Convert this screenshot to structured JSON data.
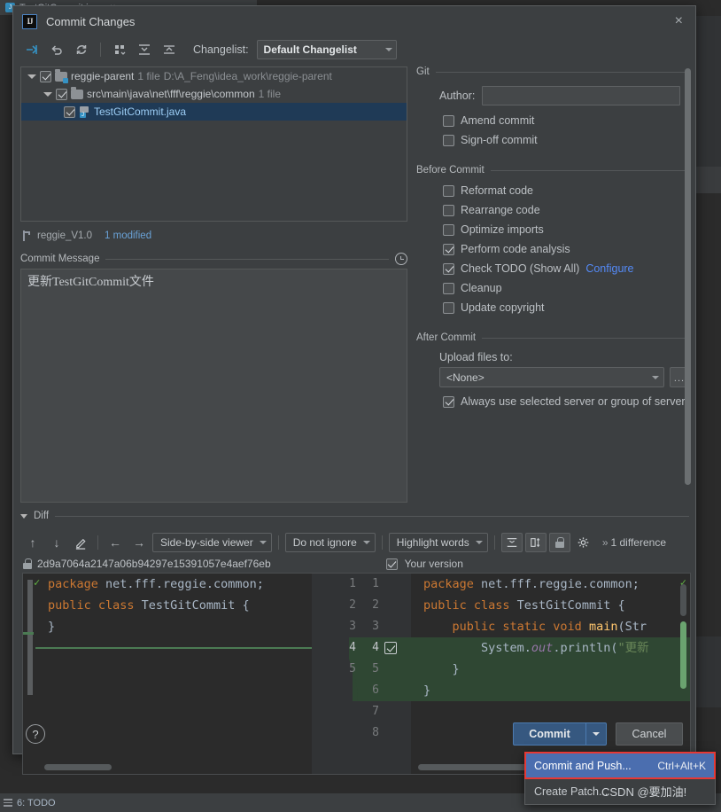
{
  "ide": {
    "tab_label": "TestGitCommit.java",
    "tab_close": "×",
    "statusbar_label": "6: TODO"
  },
  "dialog": {
    "title": "Commit Changes",
    "close_label": "×",
    "logo_text": "IJ"
  },
  "toolbar": {
    "changelist_label": "Changelist:",
    "changelist_value": "Default Changelist",
    "icons": [
      "move-to-changelist-icon",
      "revert-icon",
      "refresh-icon",
      "group-by-icon",
      "expand-all-icon",
      "collapse-all-icon"
    ]
  },
  "file_tree": {
    "rows": [
      {
        "name": "reggie-parent",
        "meta": "1 file",
        "path": "D:\\A_Feng\\idea_work\\reggie-parent",
        "checked": true,
        "expanded": true,
        "selected": false
      },
      {
        "name": "src\\main\\java\\net\\fff\\reggie\\common",
        "meta": "1 file",
        "path": "",
        "checked": true,
        "expanded": true,
        "selected": false
      },
      {
        "name": "TestGitCommit.java",
        "meta": "",
        "path": "",
        "checked": true,
        "expanded": false,
        "selected": true
      }
    ]
  },
  "branch": {
    "name": "reggie_V1.0",
    "modified": "1 modified"
  },
  "commit_message": {
    "label": "Commit Message",
    "value": "更新TestGitCommit文件",
    "history_icon": "clock-icon"
  },
  "options": {
    "git_group": "Git",
    "author_label": "Author:",
    "author_value": "",
    "git_checkboxes": [
      {
        "label": "Amend commit",
        "checked": false
      },
      {
        "label": "Sign-off commit",
        "checked": false
      }
    ],
    "before_commit_group": "Before Commit",
    "before_commit": [
      {
        "label": "Reformat code",
        "checked": false,
        "link": ""
      },
      {
        "label": "Rearrange code",
        "checked": false,
        "link": ""
      },
      {
        "label": "Optimize imports",
        "checked": false,
        "link": ""
      },
      {
        "label": "Perform code analysis",
        "checked": true,
        "link": ""
      },
      {
        "label": "Check TODO (Show All)",
        "checked": true,
        "link": "Configure"
      },
      {
        "label": "Cleanup",
        "checked": false,
        "link": ""
      },
      {
        "label": "Update copyright",
        "checked": false,
        "link": ""
      }
    ],
    "after_commit_group": "After Commit",
    "upload_label": "Upload files to:",
    "upload_value": "<None>",
    "upload_ellipsis": "...",
    "always_use_label": "Always use selected server or group of servers",
    "always_use_checked": true
  },
  "diff": {
    "section_label": "Diff",
    "toolbar": {
      "prev_icon": "↑",
      "next_icon": "↓",
      "edit_icon": "✎",
      "back_icon": "←",
      "forward_icon": "→",
      "viewer_mode": "Side-by-side viewer",
      "ignore_mode": "Do not ignore",
      "highlight_mode": "Highlight words",
      "collapse_icon": "collapse-unchanged-icon",
      "sync-scroll_icon": "sync-scroll-icon",
      "lock_icon": "lock-icon",
      "settings_icon": "gear-icon",
      "chevrons": "»",
      "difference_count": "1 difference"
    },
    "left_revision": "2d9a7064a2147a06b94297e15391057e4aef76eb",
    "right_label": "Your version",
    "right_label_checked": true,
    "left_pane": {
      "line_numbers": [
        "1",
        "2",
        "3",
        "4",
        "5"
      ],
      "lines": [
        {
          "tokens": [
            {
              "t": "package",
              "c": "kw"
            },
            {
              "t": " net.fff.reggie.common;",
              "c": "plain"
            }
          ],
          "added": false
        },
        {
          "tokens": [
            {
              "t": "",
              "c": "plain"
            }
          ],
          "added": false
        },
        {
          "tokens": [
            {
              "t": "public class",
              "c": "kw"
            },
            {
              "t": " TestGitCommit {",
              "c": "plain"
            }
          ],
          "added": false
        },
        {
          "tokens": [
            {
              "t": "}",
              "c": "plain"
            }
          ],
          "added": false
        },
        {
          "tokens": [
            {
              "t": "",
              "c": "plain"
            }
          ],
          "added": false
        }
      ]
    },
    "right_pane": {
      "line_numbers": [
        "1",
        "2",
        "3",
        "4",
        "5",
        "6",
        "7",
        "8"
      ],
      "lines": [
        {
          "tokens": [
            {
              "t": "package",
              "c": "kw"
            },
            {
              "t": " net.fff.reggie.common;",
              "c": "plain"
            }
          ],
          "added": false
        },
        {
          "tokens": [
            {
              "t": "",
              "c": "plain"
            }
          ],
          "added": false
        },
        {
          "tokens": [
            {
              "t": "public class",
              "c": "kw"
            },
            {
              "t": " TestGitCommit {",
              "c": "plain"
            }
          ],
          "added": false
        },
        {
          "tokens": [
            {
              "t": "    ",
              "c": "plain"
            },
            {
              "t": "public static void",
              "c": "kw"
            },
            {
              "t": " ",
              "c": "plain"
            },
            {
              "t": "main",
              "c": "fn"
            },
            {
              "t": "(Str",
              "c": "plain"
            }
          ],
          "added": true
        },
        {
          "tokens": [
            {
              "t": "        System.",
              "c": "plain"
            },
            {
              "t": "out",
              "c": "fld"
            },
            {
              "t": ".println(",
              "c": "plain"
            },
            {
              "t": "\"更新",
              "c": "str"
            }
          ],
          "added": true
        },
        {
          "tokens": [
            {
              "t": "    }",
              "c": "plain"
            }
          ],
          "added": true
        },
        {
          "tokens": [
            {
              "t": "}",
              "c": "plain"
            }
          ],
          "added": false
        },
        {
          "tokens": [
            {
              "t": "",
              "c": "plain"
            }
          ],
          "added": false
        }
      ],
      "diff_checkbox_line": 4
    }
  },
  "footer": {
    "help_label": "?",
    "commit_label": "Commit",
    "cancel_label": "Cancel"
  },
  "commit_menu": {
    "items": [
      {
        "label": "Commit and Push...",
        "shortcut": "Ctrl+Alt+K",
        "highlighted": true
      },
      {
        "label": "Create Patch...",
        "shortcut": "",
        "highlighted": false
      }
    ],
    "watermark": "CSDN @要加油!"
  }
}
